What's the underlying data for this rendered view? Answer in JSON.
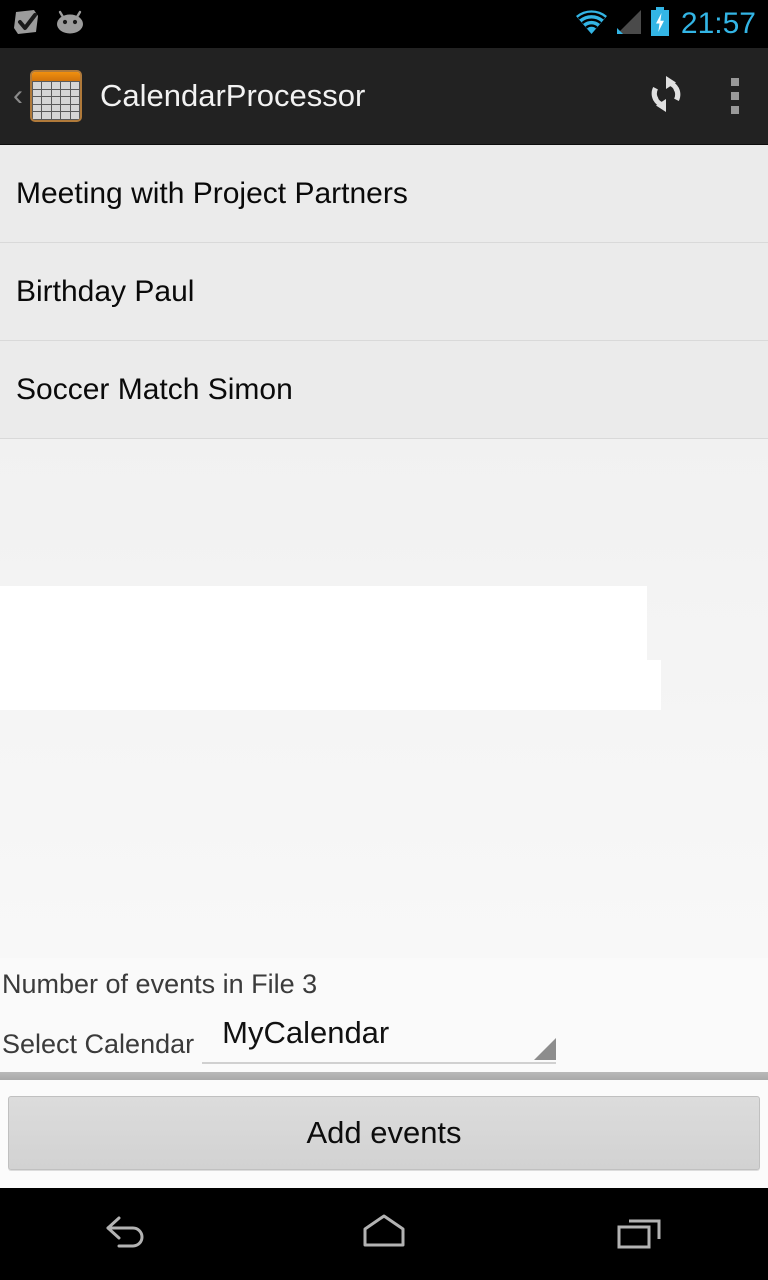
{
  "status_bar": {
    "left_icons": [
      "checkmark-badge-icon",
      "android-head-icon"
    ],
    "right_icons": [
      "wifi-icon",
      "cell-signal-icon",
      "battery-charging-icon"
    ],
    "clock": "21:57",
    "clock_color": "#33b5e5",
    "background": "#000000"
  },
  "action_bar": {
    "up_chevron": "‹",
    "app_icon": "calendar-app-icon",
    "title": "CalendarProcessor",
    "refresh_icon": "refresh-icon",
    "overflow_icon": "overflow-menu-icon",
    "background": "#222222"
  },
  "event_list": {
    "items": [
      {
        "label": "Meeting with Project Partners"
      },
      {
        "label": "Birthday Paul"
      },
      {
        "label": "Soccer Match Simon"
      }
    ]
  },
  "form": {
    "count_text": "Number of events in File 3",
    "spinner_label": "Select Calendar",
    "spinner_value": "MyCalendar",
    "spinner_options": [
      "MyCalendar"
    ],
    "spinner_arrow_color": "#8d8d8d"
  },
  "footer": {
    "add_button_label": "Add events"
  },
  "nav_bar": {
    "back": "back-icon",
    "home": "home-icon",
    "recents": "recents-icon",
    "background": "#000000"
  }
}
